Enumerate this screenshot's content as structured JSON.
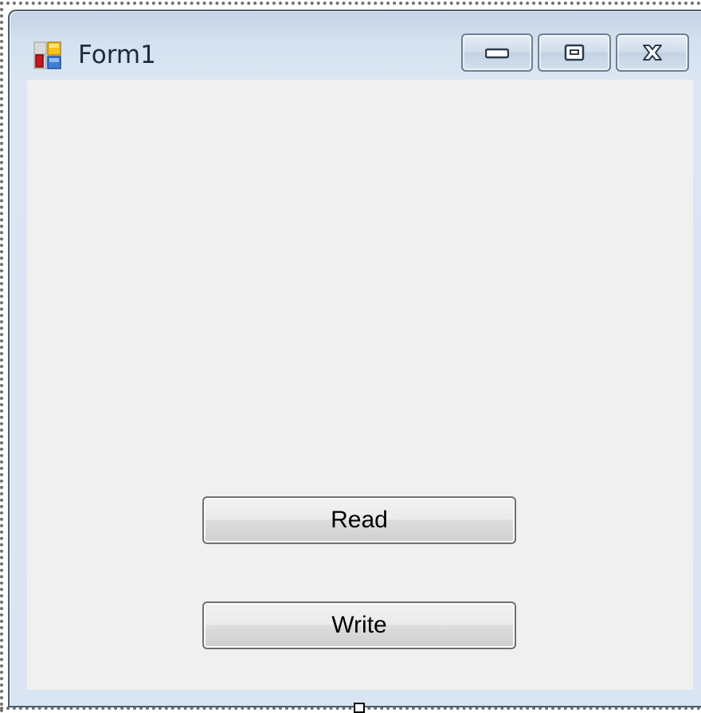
{
  "window": {
    "title": "Form1",
    "icon": "winforms-app-icon",
    "controls": {
      "minimize_icon": "minimize-icon",
      "maximize_icon": "maximize-icon",
      "close_icon": "close-icon"
    }
  },
  "buttons": {
    "read_label": "Read",
    "write_label": "Write"
  },
  "colors": {
    "client_background": "#f0f0f0",
    "frame_blue": "#d4e1ef",
    "button_border": "#707070"
  }
}
